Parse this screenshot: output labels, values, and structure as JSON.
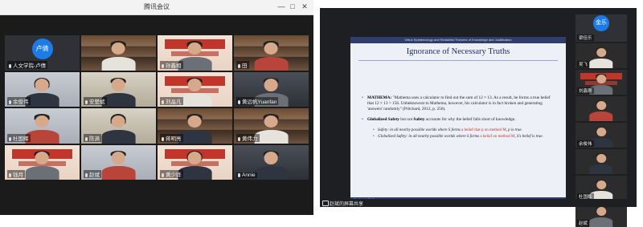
{
  "left_window": {
    "title": "腾讯会议",
    "controls": [
      "—",
      "□",
      "✕"
    ],
    "participants": [
      {
        "name": "人文学院-卢倩",
        "kind": "avatar",
        "avatar_text": "卢倩"
      },
      {
        "name": "",
        "kind": "shelf"
      },
      {
        "name": "孙鑫相",
        "kind": "banner"
      },
      {
        "name": "田",
        "kind": "shelf"
      },
      {
        "name": "余俊伟",
        "kind": "room"
      },
      {
        "name": "安楚斌",
        "kind": "office"
      },
      {
        "name": "刘晶凡",
        "kind": "banner"
      },
      {
        "name": "黄远帆Yuanfan",
        "kind": "dark"
      },
      {
        "name": "杜国辉",
        "kind": "room"
      },
      {
        "name": "陈满",
        "kind": "office"
      },
      {
        "name": "蒋明亮",
        "kind": "shelf"
      },
      {
        "name": "黄伟力",
        "kind": "shelf"
      },
      {
        "name": "钱月",
        "kind": "banner"
      },
      {
        "name": "赵斌",
        "kind": "room"
      },
      {
        "name": "黄少骅",
        "kind": "banner"
      },
      {
        "name": "Annie",
        "kind": "dark"
      }
    ]
  },
  "right_window": {
    "slide": {
      "top_strip": "Virtue Epistemology and Reliabilist Theories of Knowledge and Justification",
      "title": "Ignorance of Necessary Truths",
      "bullet1_label": "MATHEMA:",
      "bullet1_text": " \"Mathema uses a calculator to find out the sum of 12 × 13. As a result, he forms a true belief that 12 × 13 = 156. Unbeknownst to Mathema, however, his calculator is in fact broken and generating 'answers' randomly\" (Pritchard, 2012, p. 256).",
      "bullet2_a": "Globalized Safety",
      "bullet2_b": " but not ",
      "bullet2_c": "Safety",
      "bullet2_d": " accounts for why the belief falls short of knowledge.",
      "sub1_a": "Safety: in all nearby possible worlds where S forms ",
      "sub1_red": "a belief that p on method M",
      "sub1_b": ", p is true.",
      "sub2_a": "Globalized Safety: in all nearby possible worlds where S forms ",
      "sub2_red": "a belief on method M",
      "sub2_b": ", S's belief is true.",
      "footer": "Wu Jian | UCL Europe"
    },
    "sidebar": [
      {
        "name": "梁佳乐",
        "kind": "avatar",
        "avatar_text": "金乐"
      },
      {
        "name": "吴飞",
        "kind": "shelf"
      },
      {
        "name": "刘鑫刚",
        "kind": "banner"
      },
      {
        "name": "",
        "kind": "room"
      },
      {
        "name": "余俊伟",
        "kind": "office"
      },
      {
        "name": "",
        "kind": "room"
      },
      {
        "name": "杜国辉",
        "kind": "room"
      },
      {
        "name": "赵斌",
        "kind": "office"
      }
    ],
    "share_bar": "赵斌的屏幕共享"
  },
  "colors": {
    "avatar": "#1d7be8",
    "slide_accent": "#2f3e6b",
    "highlight": "#c0302b"
  }
}
